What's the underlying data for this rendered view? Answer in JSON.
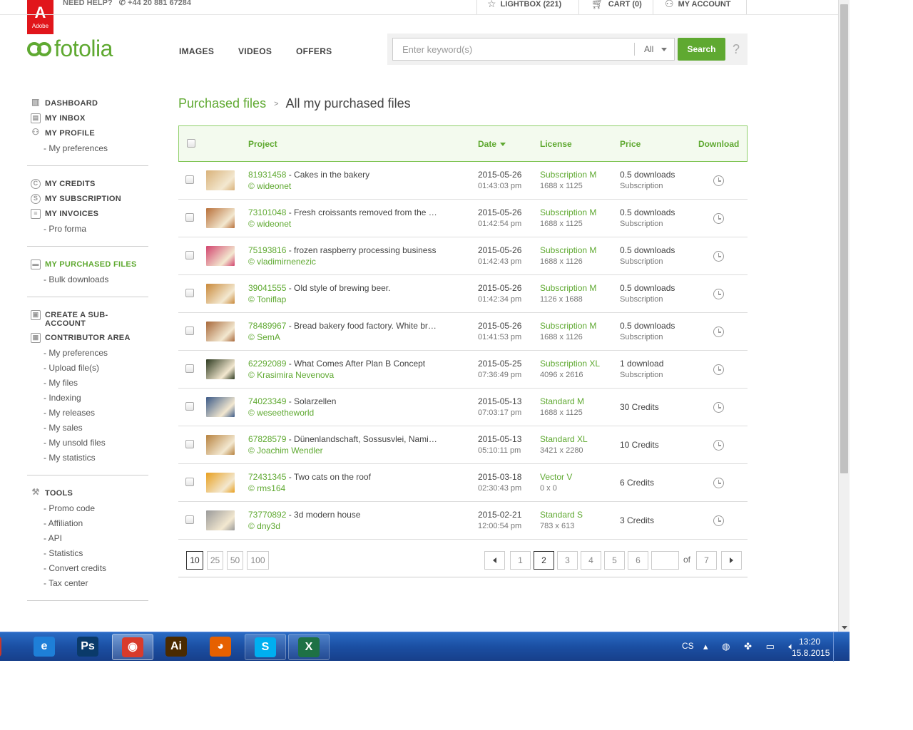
{
  "header": {
    "brand_top": "Adobe",
    "need_help": "NEED HELP?",
    "phone": "+44 20 881 67284",
    "lightbox": "LIGHTBOX (221)",
    "cart": "CART (0)",
    "account": "MY ACCOUNT",
    "logo": "fotolia",
    "nav": [
      "IMAGES",
      "VIDEOS",
      "OFFERS"
    ],
    "search_placeholder": "Enter keyword(s)",
    "search_scope": "All",
    "search_button": "Search",
    "help": "?"
  },
  "sidebar": {
    "sections": [
      {
        "items": [
          {
            "type": "head",
            "label": "DASHBOARD",
            "icon": "chart-icon"
          },
          {
            "type": "head",
            "label": "MY INBOX",
            "icon": "inbox-icon"
          },
          {
            "type": "head",
            "label": "MY PROFILE",
            "icon": "user-icon"
          },
          {
            "type": "sub",
            "label": "- My preferences"
          }
        ]
      },
      {
        "items": [
          {
            "type": "head",
            "label": "MY CREDITS",
            "icon": "credits-icon"
          },
          {
            "type": "head",
            "label": "MY SUBSCRIPTION",
            "icon": "subscription-icon"
          },
          {
            "type": "head",
            "label": "MY INVOICES",
            "icon": "invoice-icon"
          },
          {
            "type": "sub",
            "label": "- Pro forma"
          }
        ]
      },
      {
        "items": [
          {
            "type": "head",
            "label": "MY PURCHASED FILES",
            "icon": "purchased-icon",
            "active": true
          },
          {
            "type": "sub",
            "label": "- Bulk downloads"
          }
        ]
      },
      {
        "items": [
          {
            "type": "head",
            "label": "CREATE A SUB-ACCOUNT",
            "icon": "briefcase-icon"
          },
          {
            "type": "head",
            "label": "CONTRIBUTOR AREA",
            "icon": "grid-icon"
          },
          {
            "type": "sub",
            "label": "- My preferences"
          },
          {
            "type": "sub",
            "label": "- Upload file(s)"
          },
          {
            "type": "sub",
            "label": "- My files"
          },
          {
            "type": "sub",
            "label": "- Indexing"
          },
          {
            "type": "sub",
            "label": "- My releases"
          },
          {
            "type": "sub",
            "label": "- My sales"
          },
          {
            "type": "sub",
            "label": "- My unsold files"
          },
          {
            "type": "sub",
            "label": "- My statistics"
          }
        ]
      },
      {
        "items": [
          {
            "type": "head",
            "label": "TOOLS",
            "icon": "tools-icon"
          },
          {
            "type": "sub",
            "label": "- Promo code"
          },
          {
            "type": "sub",
            "label": "- Affiliation"
          },
          {
            "type": "sub",
            "label": "- API"
          },
          {
            "type": "sub",
            "label": "- Statistics"
          },
          {
            "type": "sub",
            "label": "- Convert credits"
          },
          {
            "type": "sub",
            "label": "- Tax center"
          }
        ]
      }
    ]
  },
  "breadcrumb": {
    "root": "Purchased files",
    "sep": ">",
    "current": "All my purchased files"
  },
  "table": {
    "columns": [
      "Project",
      "Date",
      "License",
      "Price",
      "Download"
    ],
    "rows": [
      {
        "id": "81931458",
        "title": " - Cakes in the bakery",
        "author": "© wideonet",
        "date": "2015-05-26",
        "time": "01:43:03 pm",
        "license": "Subscription M",
        "dim": "1688 x 1125",
        "price": "0.5 downloads",
        "ptype": "Subscription",
        "thumb": "#d9b27a"
      },
      {
        "id": "73101048",
        "title": " - Fresh croissants removed from the …",
        "author": "© wideonet",
        "date": "2015-05-26",
        "time": "01:42:54 pm",
        "license": "Subscription M",
        "dim": "1688 x 1125",
        "price": "0.5 downloads",
        "ptype": "Subscription",
        "thumb": "#b8703a"
      },
      {
        "id": "75193816",
        "title": " - frozen raspberry processing business",
        "author": "© vladimirnenezic",
        "date": "2015-05-26",
        "time": "01:42:43 pm",
        "license": "Subscription M",
        "dim": "1688 x 1126",
        "price": "0.5 downloads",
        "ptype": "Subscription",
        "thumb": "#d2446e"
      },
      {
        "id": "39041555",
        "title": " - Old style of brewing beer.",
        "author": "© Toniflap",
        "date": "2015-05-26",
        "time": "01:42:34 pm",
        "license": "Subscription M",
        "dim": "1126 x 1688",
        "price": "0.5 downloads",
        "ptype": "Subscription",
        "thumb": "#c9893a"
      },
      {
        "id": "78489967",
        "title": " - Bread bakery food factory. White br…",
        "author": "© SemA",
        "date": "2015-05-26",
        "time": "01:41:53 pm",
        "license": "Subscription M",
        "dim": "1688 x 1126",
        "price": "0.5 downloads",
        "ptype": "Subscription",
        "thumb": "#a8683a"
      },
      {
        "id": "62292089",
        "title": " - What Comes After Plan B Concept",
        "author": "© Krasimira Nevenova",
        "date": "2015-05-25",
        "time": "07:36:49 pm",
        "license": "Subscription XL",
        "dim": "4096 x 2616",
        "price": "1 download",
        "ptype": "Subscription",
        "thumb": "#2d3a20"
      },
      {
        "id": "74023349",
        "title": " - Solarzellen",
        "author": "© weseetheworld",
        "date": "2015-05-13",
        "time": "07:03:17 pm",
        "license": "Standard M",
        "dim": "1688 x 1125",
        "price": "30 Credits",
        "ptype": "",
        "thumb": "#3c5a88"
      },
      {
        "id": "67828579",
        "title": " - Dünenlandschaft, Sossusvlei, Nami…",
        "author": "© Joachim Wendler",
        "date": "2015-05-13",
        "time": "05:10:11 pm",
        "license": "Standard XL",
        "dim": "3421 x 2280",
        "price": "10 Credits",
        "ptype": "",
        "thumb": "#b7823f"
      },
      {
        "id": "72431345",
        "title": " - Two cats on the roof",
        "author": "© rms164",
        "date": "2015-03-18",
        "time": "02:30:43 pm",
        "license": "Vector V",
        "dim": "0 x 0",
        "price": "6 Credits",
        "ptype": "",
        "thumb": "#e8a020"
      },
      {
        "id": "73770892",
        "title": " - 3d modern house",
        "author": "© dny3d",
        "date": "2015-02-21",
        "time": "12:00:54 pm",
        "license": "Standard S",
        "dim": "783 x 613",
        "price": "3 Credits",
        "ptype": "",
        "thumb": "#9a9a9a"
      }
    ]
  },
  "pager": {
    "per_page": [
      "10",
      "25",
      "50",
      "100"
    ],
    "per_page_selected": "10",
    "pages": [
      "1",
      "2",
      "3",
      "4",
      "5",
      "6"
    ],
    "current_page": "2",
    "of": "of",
    "total": "7"
  },
  "taskbar": {
    "apps": [
      {
        "name": "ie-icon",
        "glyph": "e",
        "color": "#1e7fd8"
      },
      {
        "name": "photoshop-icon",
        "glyph": "Ps",
        "color": "#0a3a6a"
      },
      {
        "name": "chrome-icon",
        "glyph": "◉",
        "color": "#d93b2b",
        "active": true
      },
      {
        "name": "illustrator-icon",
        "glyph": "Ai",
        "color": "#4a2a00"
      },
      {
        "name": "firefox-icon",
        "glyph": "◕",
        "color": "#e66000"
      },
      {
        "name": "skype-icon",
        "glyph": "S",
        "color": "#00aff0",
        "open": true
      },
      {
        "name": "excel-icon",
        "glyph": "X",
        "color": "#1e7145",
        "open": true
      }
    ],
    "lang": "CS",
    "time": "13:20",
    "date": "15.8.2015"
  }
}
